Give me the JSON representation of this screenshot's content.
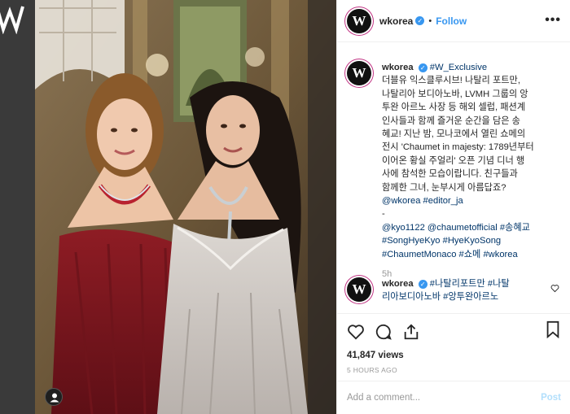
{
  "header": {
    "username": "wkorea",
    "separator": "•",
    "follow_label": "Follow",
    "more_label": "•••",
    "avatar_letter": "W"
  },
  "caption": {
    "username": "wkorea",
    "lines": [
      [
        "#W_Exclusive"
      ],
      [
        "더블유 익스클루시브! 나탈리 포트만,"
      ],
      [
        "나탈리아 보디아노바, LVMH 그룹의 앙"
      ],
      [
        "투완 아르노 사장 등 해외 셀럽, 패션계"
      ],
      [
        "인사들과 함께 즐거운 순간을 담은 송"
      ],
      [
        "혜교! 지난 밤, 모나코에서 열린 쇼메의"
      ],
      [
        "전시 'Chaumet in majesty: 1789년부터"
      ],
      [
        "이어온 황실 주얼리' 오픈 기념 디너 행"
      ],
      [
        "사에 참석한 모습이랍니다. 친구들과"
      ],
      [
        "함께한 그녀, 눈부시게 아름답죠?"
      ]
    ],
    "tags_line1": "@wkorea #editor_ja",
    "dash": "-",
    "tags_line2": "@kyo1122 @chaumetofficial #송혜교",
    "tags_line3": "#SongHyeKyo #HyeKyoSong",
    "tags_line4": "#ChaumetMonaco #쇼메 #wkorea",
    "time": "5h"
  },
  "comment": {
    "username": "wkorea",
    "text_line1": "#나탈리포트만 #나탈",
    "text_line2": "리아보디아노바 #앙투완아르노"
  },
  "stats": {
    "views": "41,847 views",
    "ago": "5 HOURS AGO"
  },
  "composer": {
    "placeholder": "Add a comment...",
    "post_label": "Post"
  },
  "colors": {
    "accent": "#3897f0",
    "link": "#003569",
    "muted": "#999999",
    "post_disabled": "#b2dffc"
  }
}
